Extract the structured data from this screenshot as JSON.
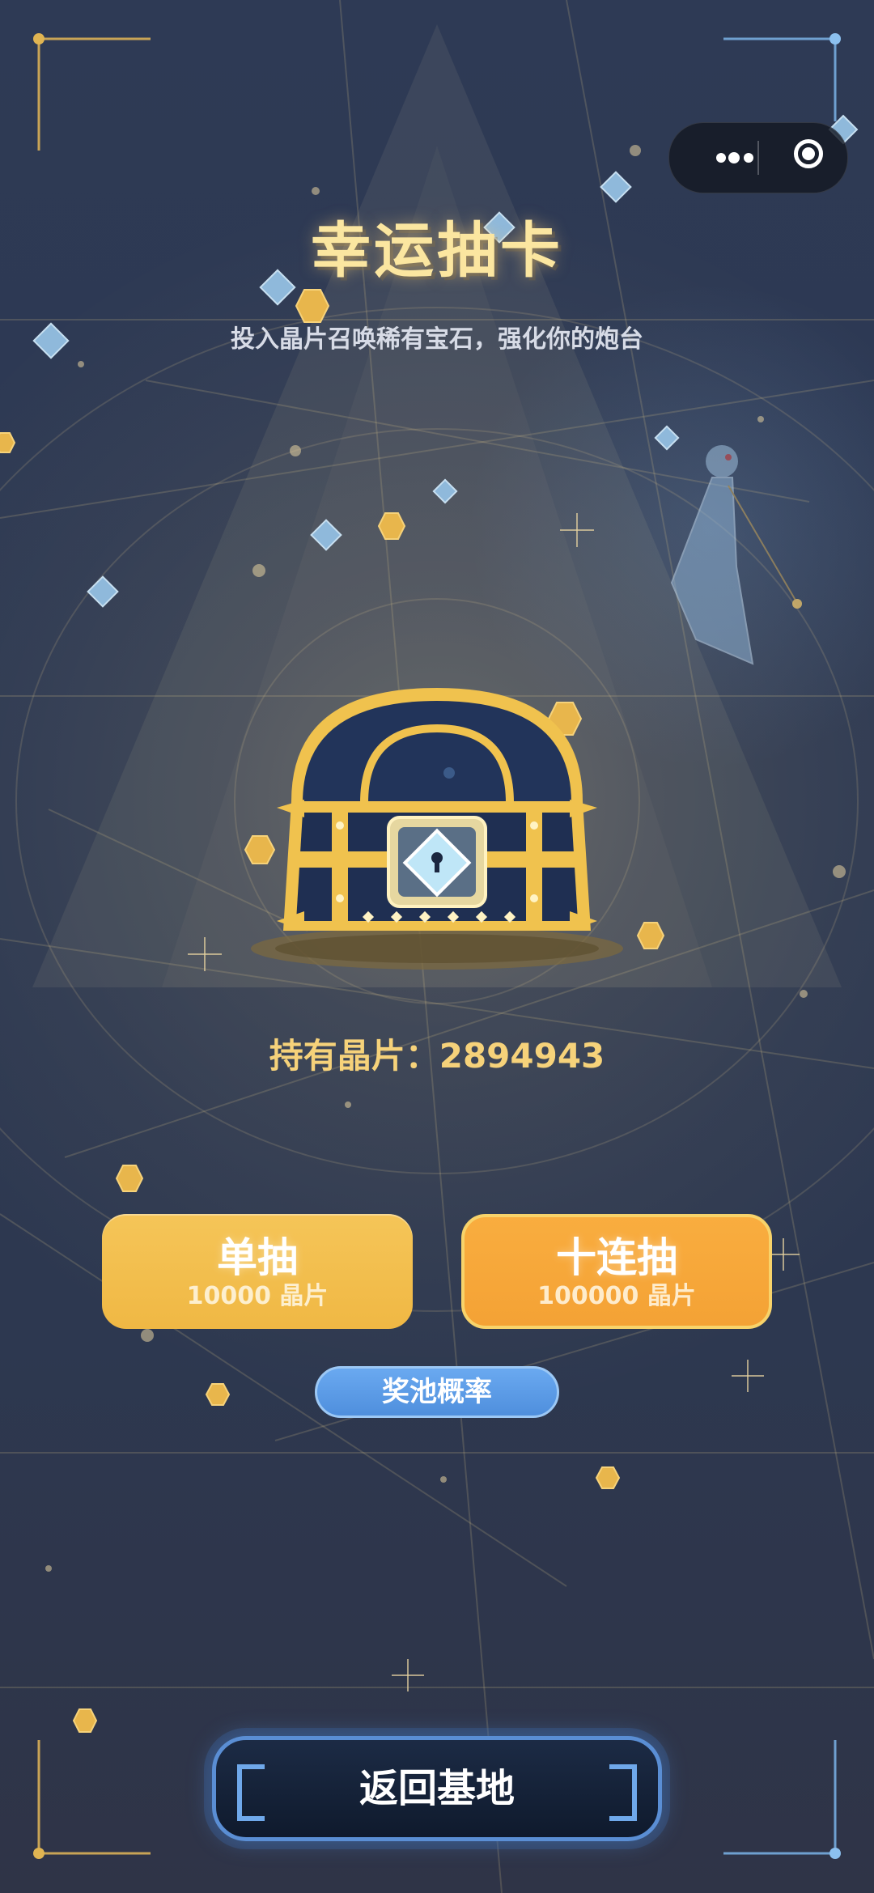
{
  "header": {
    "title": "幸运抽卡",
    "subtitle": "投入晶片召唤稀有宝石，强化你的炮台"
  },
  "capsule": {
    "more_icon": "more-dots-icon",
    "close_icon": "target-close-icon"
  },
  "balance": {
    "label": "持有晶片：",
    "value": "2894943"
  },
  "actions": {
    "single": {
      "label": "单抽",
      "cost": "10000 晶片"
    },
    "ten": {
      "label": "十连抽",
      "cost": "100000 晶片"
    },
    "odds": {
      "label": "奖池概率"
    },
    "back": {
      "label": "返回基地"
    }
  },
  "colors": {
    "accent_gold": "#f6d27a",
    "single_button": "#f0b844",
    "ten_button": "#f4a235",
    "odds_button": "#5b9be6",
    "back_border": "#5a8ed4"
  }
}
